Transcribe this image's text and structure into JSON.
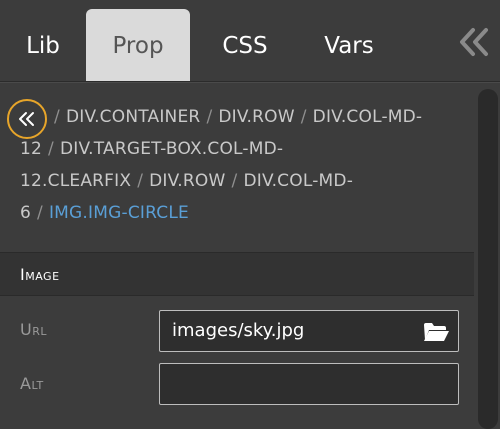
{
  "tabs": {
    "lib": "Lib",
    "prop": "Prop",
    "css": "CSS",
    "vars": "Vars",
    "active": "Prop"
  },
  "breadcrumb": {
    "back_icon": "double-chevron-left-icon",
    "separator": "/",
    "items": [
      "DIV.CONTAINER",
      "DIV.ROW",
      "DIV.COL-MD-12",
      "DIV.TARGET-BOX.COL-MD-12.CLEARFIX",
      "DIV.ROW",
      "DIV.COL-MD-6",
      "IMG.IMG-CIRCLE"
    ]
  },
  "image_section": {
    "title": "Image",
    "url_label": "Url",
    "url_value": "images/sky.jpg",
    "alt_label": "Alt",
    "alt_value": "",
    "folder_icon": "folder-open-icon"
  },
  "colors": {
    "background": "#3c3c3c",
    "active_tab": "#dadada",
    "highlight_ring": "#e7a52a",
    "current_crumb": "#5a9fd6"
  }
}
